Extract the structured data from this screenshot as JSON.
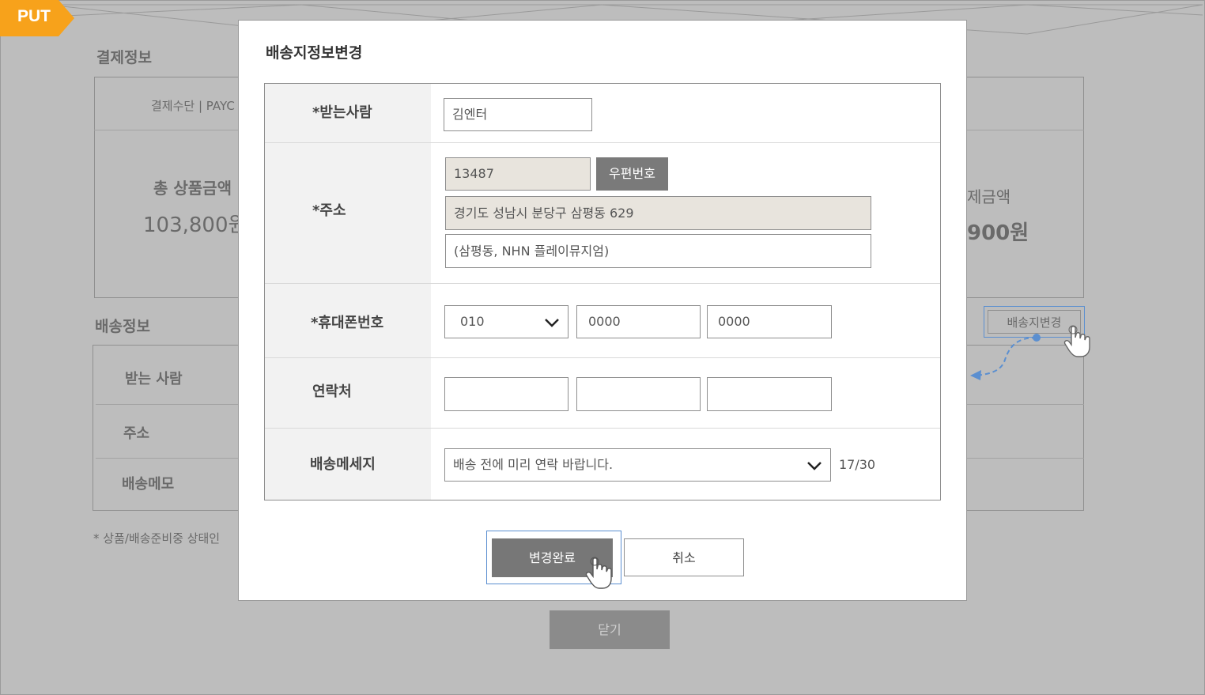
{
  "badge": {
    "label": "PUT"
  },
  "background": {
    "payment_section_title": "결제정보",
    "payment_method_label": "결제수단 | PAYC",
    "total_product_label": "총 상품금액",
    "total_product_value": "103,800원",
    "right_amount_label": "제금액",
    "right_amount_value": "900원",
    "shipping_section_title": "배송정보",
    "change_address_button": "배송지변경",
    "rows": [
      "받는 사람",
      "주소",
      "배송메모"
    ],
    "note": "* 상품/배송준비중 상태인",
    "close_button": "닫기"
  },
  "modal": {
    "title": "배송지정보변경",
    "recipient": {
      "label": "*받는사람",
      "value": "김엔터"
    },
    "address": {
      "label": "*주소",
      "zipcode": "13487",
      "zip_button": "우편번호",
      "line1": "경기도 성남시 분당구 삼평동 629",
      "line2": "(삼평동, NHN 플레이뮤지엄)"
    },
    "mobile": {
      "label": "*휴대폰번호",
      "prefix": "010",
      "middle": "0000",
      "last": "0000"
    },
    "contact": {
      "label": "연락처",
      "part1": "",
      "part2": "",
      "part3": ""
    },
    "message": {
      "label": "배송메세지",
      "value": "배송 전에 미리 연락 바랍니다.",
      "count": "17/30"
    },
    "confirm_button": "변경완료",
    "cancel_button": "취소"
  },
  "colors": {
    "accent": "#5b8fd0",
    "badge": "#f7a21b",
    "dim": "#bdbdbd"
  }
}
